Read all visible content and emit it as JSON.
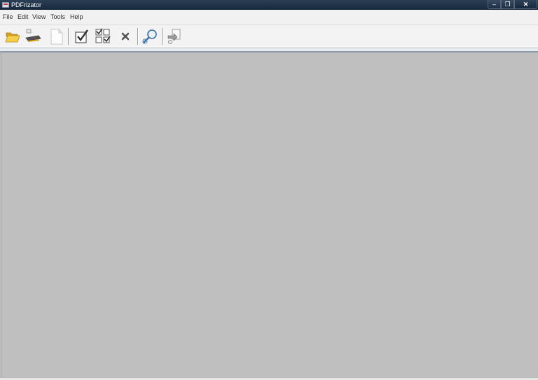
{
  "window": {
    "title": "PDFrizator",
    "controls": {
      "minimize": "–",
      "maximize": "❐",
      "close": "✕"
    }
  },
  "menu": [
    "File",
    "Edit",
    "View",
    "Tools",
    "Help"
  ],
  "toolbar": {
    "buttons": [
      {
        "icon": "folder-open-icon"
      },
      {
        "icon": "scan-icon"
      },
      {
        "icon": "new-document-icon"
      },
      {
        "icon": "check-icon"
      },
      {
        "icon": "check-all-icon"
      },
      {
        "icon": "delete-icon"
      },
      {
        "icon": "search-icon"
      },
      {
        "icon": "document-export-icon"
      }
    ]
  },
  "colors": {
    "workspace": "#bfbfbf",
    "titlebar": "#1b2d41",
    "toolbar": "#f3f3f3"
  }
}
